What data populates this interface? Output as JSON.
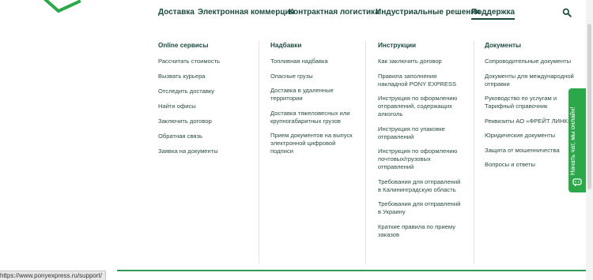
{
  "header": {
    "nav": [
      {
        "label": "Доставка"
      },
      {
        "label": "Электронная коммерция"
      },
      {
        "label": "Контрактная логистика"
      },
      {
        "label": "Индустриальные решения"
      },
      {
        "label": "Поддержка",
        "active": true
      }
    ],
    "search_icon": "search-icon",
    "logo_icon": "logo-mark"
  },
  "menu": {
    "columns": [
      {
        "title": "Online сервисы",
        "items": [
          "Рассчитать стоимость",
          "Вызвать курьера",
          "Отследить доставку",
          "Найти офисы",
          "Заключить договор",
          "Обратная связь",
          "Заявка на документы"
        ]
      },
      {
        "title": "Надбавки",
        "items": [
          "Топливная надбавка",
          "Опасные грузы",
          "Доставка в удаленные территории",
          "Доставка тяжеловесных или крупногабаритных грузов",
          "Прием документов на выпуск электронной цифровой подписи"
        ]
      },
      {
        "title": "Инструкции",
        "items": [
          "Как заключить договор",
          "Правила заполнения накладной PONY EXPRESS",
          "Инструкция по оформлению отправлений, содержащих алкоголь",
          "Инструкция по упаковке отправлений",
          "Инструкция по оформлению почтовых/грузовых отправлений",
          "Требования для отправлений в Калининградскую область",
          "Требования для отправлений в Украину",
          "Краткие правила по приему заказов"
        ]
      },
      {
        "title": "Документы",
        "items": [
          "Сопроводительные документы",
          "Документы для международной отправки",
          "Руководство по услугам и Тарифный справочник",
          "Реквизиты АО «ФРЕЙТ ЛИНК»",
          "Юридические документы",
          "Защита от мошенничества",
          "Вопросы и ответы"
        ]
      }
    ]
  },
  "chat": {
    "label": "Начать чат, мы онлайн!",
    "icon": "chat-icon",
    "color": "#2ba84a"
  },
  "status_bar": {
    "url": "https://www.ponyexpress.ru/support/"
  },
  "colors": {
    "brand_green": "#2ba84a",
    "text_dark_green": "#1d4a3f",
    "accent_line": "#2e9a52"
  }
}
